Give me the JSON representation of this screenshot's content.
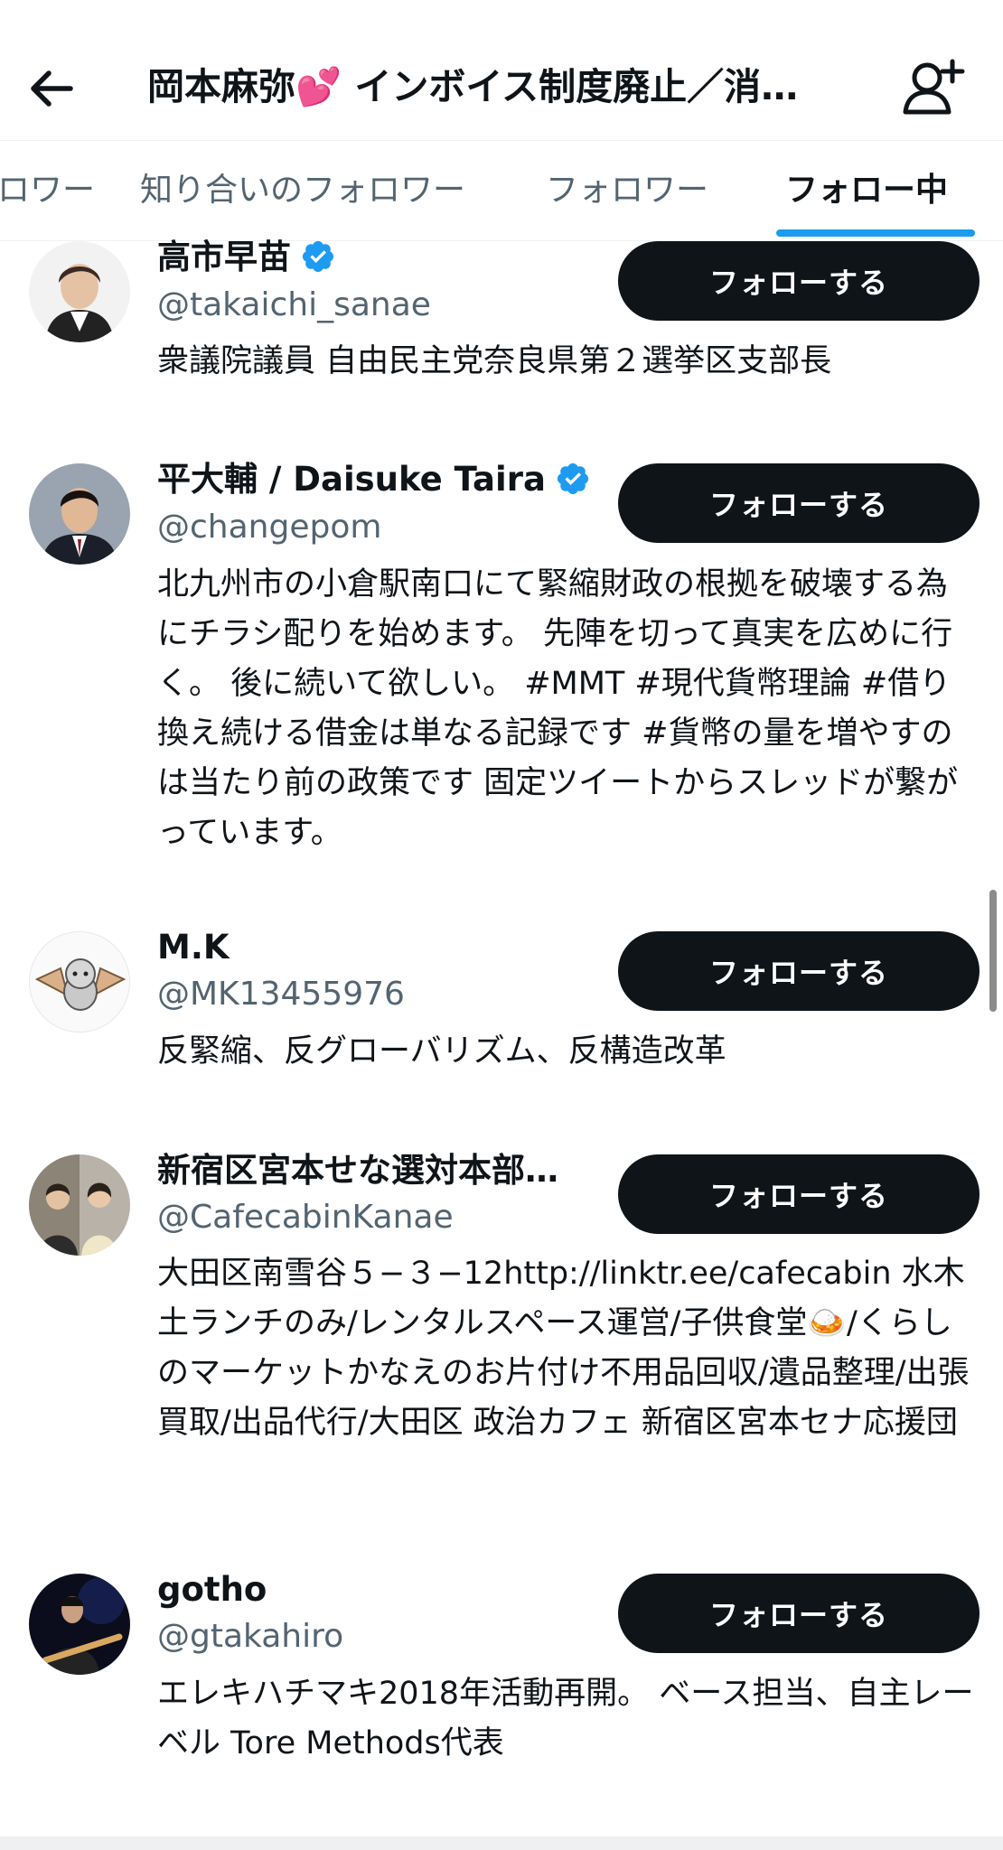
{
  "header": {
    "title": "岡本麻弥",
    "title_suffix": "インボイス制度廃止／消…",
    "back_icon": "arrow-left-icon",
    "add_user_icon": "person-add-icon"
  },
  "tabs": [
    {
      "label": "ロワー"
    },
    {
      "label": "知り合いのフォロワー"
    },
    {
      "label": "フォロワー"
    },
    {
      "label": "フォロー中",
      "active": true
    }
  ],
  "users": [
    {
      "name": "高市早苗",
      "verified": true,
      "handle": "@takaichi_sanae",
      "bio": "衆議院議員 自由民主党奈良県第２選挙区支部長",
      "button": "フォローする"
    },
    {
      "name": "平大輔 / Daisuke Taira",
      "verified": true,
      "handle": "@changepom",
      "bio": "北九州市の小倉駅南口にて緊縮財政の根拠を破壊する為にチラシ配りを始めます。 先陣を切って真実を広めに行く。 後に続いて欲しい。 #MMT #現代貨幣理論 #借り換え続ける借金は単なる記録です #貨幣の量を増やすのは当たり前の政策です 固定ツイートからスレッドが繋がっています。",
      "button": "フォローする"
    },
    {
      "name": "M.K",
      "verified": false,
      "handle": "@MK13455976",
      "bio": "反緊縮、反グローバリズム、反構造改革",
      "button": "フォローする"
    },
    {
      "name": "新宿区宮本せな選対本部…",
      "verified": false,
      "handle": "@CafecabinKanae",
      "bio": "大田区南雪谷５−３−12http://linktr.ee/cafecabin 水木土ランチのみ/レンタルスペース運営/子供食堂🍛/くらしのマーケットかなえのお片付け不用品回収/遺品整理/出張買取/出品代行/大田区 政治カフェ 新宿区宮本セナ応援団",
      "button": "フォローする"
    },
    {
      "name": "gotho",
      "verified": false,
      "handle": "@gtakahiro",
      "bio": "エレキハチマキ2018年活動再開。 ベース担当、自主レーベル Tore Methods代表",
      "button": "フォローする"
    }
  ],
  "colors": {
    "accent": "#1d9bf0",
    "button_bg": "#0f1419",
    "muted_text": "#536471"
  }
}
